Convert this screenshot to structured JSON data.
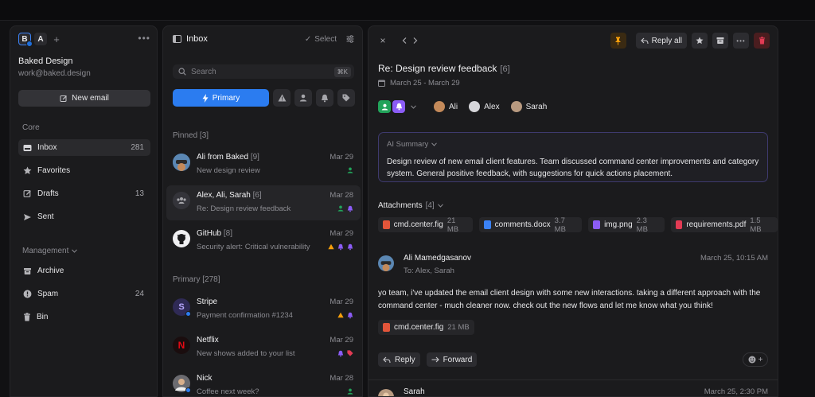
{
  "accounts": [
    {
      "letter": "B"
    },
    {
      "letter": "A"
    }
  ],
  "workspace": {
    "name": "Baked Design",
    "email": "work@baked.design"
  },
  "new_email_label": "New email",
  "core": {
    "label": "Core",
    "items": [
      {
        "label": "Inbox",
        "count": "281"
      },
      {
        "label": "Favorites",
        "count": ""
      },
      {
        "label": "Drafts",
        "count": "13"
      },
      {
        "label": "Sent",
        "count": ""
      }
    ]
  },
  "management": {
    "label": "Management",
    "items": [
      {
        "label": "Archive",
        "count": ""
      },
      {
        "label": "Spam",
        "count": "24"
      },
      {
        "label": "Bin",
        "count": ""
      }
    ]
  },
  "list": {
    "title": "Inbox",
    "select_label": "Select",
    "search_placeholder": "Search",
    "search_shortcut": "⌘K",
    "primary_filter": "Primary",
    "pinned_label": "Pinned",
    "pinned_count": "[3]",
    "primary_label": "Primary",
    "primary_count": "[278]",
    "pinned": [
      {
        "from": "Ali from Baked",
        "n": "[9]",
        "date": "Mar 29",
        "subject": "New design review"
      },
      {
        "from": "Alex, Ali, Sarah",
        "n": "[6]",
        "date": "Mar 28",
        "subject": "Re: Design review feedback"
      },
      {
        "from": "GitHub",
        "n": "[8]",
        "date": "Mar 29",
        "subject": "Security alert: Critical vulnerability"
      }
    ],
    "primary": [
      {
        "from": "Stripe",
        "n": "",
        "date": "Mar 29",
        "subject": "Payment confirmation #1234",
        "avatar_letter": "S"
      },
      {
        "from": "Netflix",
        "n": "",
        "date": "Mar 29",
        "subject": "New shows added to your list",
        "avatar_letter": "N"
      },
      {
        "from": "Nick",
        "n": "",
        "date": "Mar 28",
        "subject": "Coffee next week?"
      }
    ]
  },
  "detail": {
    "reply_all_label": "Reply all",
    "subject": "Re: Design review feedback",
    "subject_count": "[6]",
    "date_range": "March 25 - March 29",
    "people": [
      "Ali",
      "Alex",
      "Sarah"
    ],
    "ai_summary_label": "AI Summary",
    "ai_summary": "Design review of new email client features. Team discussed command center improvements and category system. General positive feedback, with suggestions for quick actions placement.",
    "attachments_label": "Attachments",
    "attachments_count": "[4]",
    "attachments": [
      {
        "name": "cmd.center.fig",
        "size": "21 MB",
        "color": "#e2553a"
      },
      {
        "name": "comments.docx",
        "size": "3.7 MB",
        "color": "#3b82f6"
      },
      {
        "name": "img.png",
        "size": "2.3 MB",
        "color": "#8b5cf6"
      },
      {
        "name": "requirements.pdf",
        "size": "1.5 MB",
        "color": "#e23b54"
      }
    ],
    "message": {
      "from": "Ali Mamedgasanov",
      "to": "To: Alex, Sarah",
      "date": "March 25, 10:15 AM",
      "body": "yo team, i've updated the email client design with some new interactions. taking a different approach with the command center - much cleaner now. check out the new flows and let me know what you think!",
      "attachment": {
        "name": "cmd.center.fig",
        "size": "21 MB"
      }
    },
    "reply_label": "Reply",
    "forward_label": "Forward",
    "message2": {
      "from": "Sarah",
      "date": "March 25, 2:30 PM"
    }
  },
  "colors": {
    "accent": "#2b7cf0",
    "green": "#22a35a",
    "purple": "#8b5cf6",
    "orange": "#f59e0b",
    "red": "#e23b54"
  }
}
